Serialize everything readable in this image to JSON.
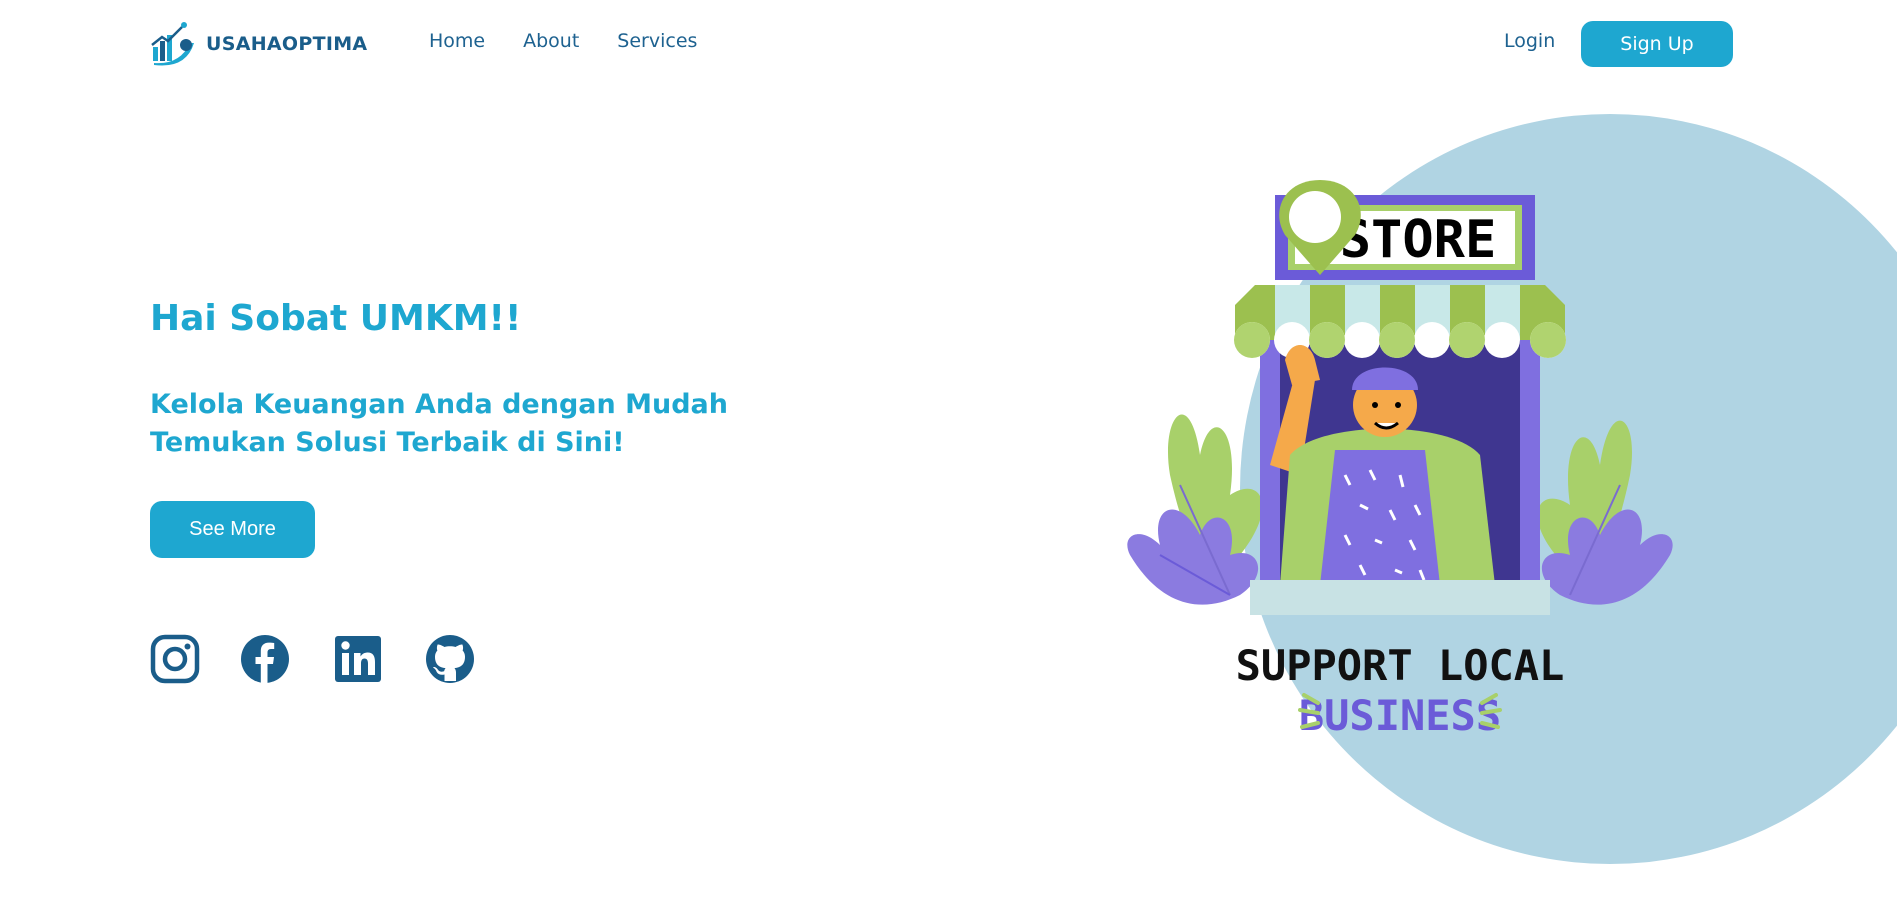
{
  "brand": {
    "name": "USAHAOPTIMA",
    "logo_icon": "chart-growth-logo-icon"
  },
  "nav": {
    "links": [
      {
        "label": "Home"
      },
      {
        "label": "About"
      },
      {
        "label": "Services"
      }
    ],
    "login_label": "Login",
    "signup_label": "Sign Up"
  },
  "hero": {
    "title": "Hai Sobat UMKM!!",
    "subtitle_line1": "Kelola Keuangan Anda dengan Mudah",
    "subtitle_line2": "Temukan Solusi Terbaik di Sini!",
    "cta_label": "See More"
  },
  "socials": [
    {
      "name": "instagram-icon"
    },
    {
      "name": "facebook-icon"
    },
    {
      "name": "linkedin-icon"
    },
    {
      "name": "github-icon"
    }
  ],
  "illustration": {
    "store_sign": "STORE",
    "caption_line1": "SUPPORT LOCAL",
    "caption_line2": "BUSINESS"
  },
  "colors": {
    "primary": "#1ea7d0",
    "dark_blue": "#1a5d8a",
    "blob": "#b0d4e3",
    "store_purple": "#6b5bd8",
    "awning_green": "#9cc04f"
  }
}
